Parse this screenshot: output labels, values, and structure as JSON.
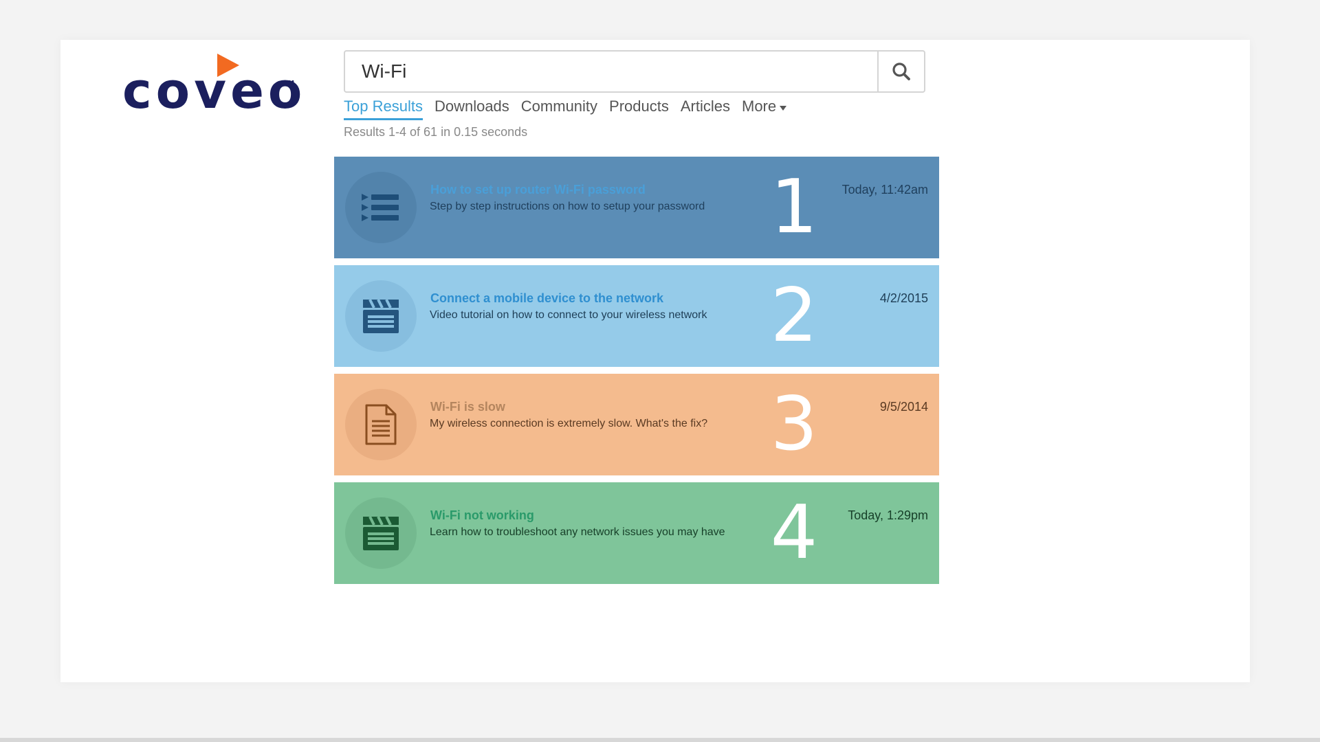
{
  "brand": {
    "name": "coveo",
    "tm": "™",
    "accent_color": "#f26a21",
    "text_color": "#1b1f5e"
  },
  "search": {
    "query": "Wi-Fi",
    "button_icon": "search-icon"
  },
  "tabs": [
    {
      "label": "Top Results",
      "active": true
    },
    {
      "label": "Downloads",
      "active": false
    },
    {
      "label": "Community",
      "active": false
    },
    {
      "label": "Products",
      "active": false
    },
    {
      "label": "Articles",
      "active": false
    },
    {
      "label": "More",
      "active": false
    }
  ],
  "summary": "Results 1-4 of 61 in 0.15 seconds",
  "results": [
    {
      "rank": "1",
      "title": "How to set up router Wi-Fi password",
      "excerpt": "Step by step instructions on how to setup your password",
      "date": "Today, 11:42am",
      "icon": "list-icon",
      "bg": "#5b8db6",
      "circle": "#5283ab",
      "title_color": "#4a9fd8",
      "excerpt_color": "#1f3f5c",
      "date_color": "#1f3f5c",
      "icon_color": "#1e4e78"
    },
    {
      "rank": "2",
      "title": "Connect a mobile device to the network",
      "excerpt": "Video tutorial on how to connect to your wireless network",
      "date": "4/2/2015",
      "icon": "clapperboard-icon",
      "bg": "#95cbe9",
      "circle": "#87bedf",
      "title_color": "#2f8fd0",
      "excerpt_color": "#1e3e56",
      "date_color": "#1e3e56",
      "icon_color": "#24557e"
    },
    {
      "rank": "3",
      "title": "Wi-Fi is slow",
      "excerpt": "My wireless connection is extremely slow. What's the fix?",
      "date": "9/5/2014",
      "icon": "document-icon",
      "bg": "#f4bb8e",
      "circle": "#eaae81",
      "title_color": "#b4855e",
      "excerpt_color": "#5a3a22",
      "date_color": "#5a3a22",
      "icon_color": "#8a4e20"
    },
    {
      "rank": "4",
      "title": "Wi-Fi not working",
      "excerpt": "Learn how to troubleshoot any network issues you may have",
      "date": "Today, 1:29pm",
      "icon": "clapperboard-icon",
      "bg": "#7fc59a",
      "circle": "#74b98f",
      "title_color": "#2a9a6a",
      "excerpt_color": "#163f28",
      "date_color": "#163f28",
      "icon_color": "#1b5a34"
    }
  ]
}
